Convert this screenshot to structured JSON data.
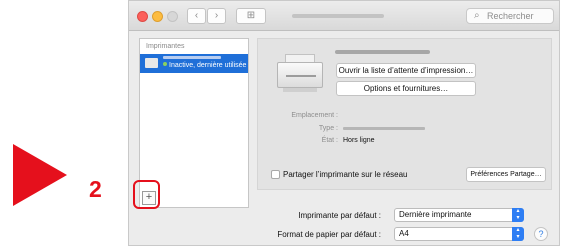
{
  "callout": {
    "step_number": "2",
    "color": "#e5101c"
  },
  "titlebar": {
    "nav_back": "‹",
    "nav_forward": "›",
    "grid_icon": "⊞",
    "search_placeholder": "Rechercher"
  },
  "sidebar": {
    "header": "Imprimantes",
    "items": [
      {
        "status": "Inactive, dernière utilisée",
        "selected": true
      }
    ],
    "add_label": "+"
  },
  "detail": {
    "open_queue_label": "Ouvrir la liste d’attente d’impression…",
    "options_label": "Options et fournitures…",
    "location_label": "Emplacement :",
    "type_label": "Type :",
    "state_label": "État :",
    "state_value": "Hors ligne",
    "share_label": "Partager l’imprimante sur le réseau",
    "share_prefs_label": "Préférences Partage…"
  },
  "defaults": {
    "default_printer_label": "Imprimante par défaut :",
    "default_printer_value": "Dernière imprimante",
    "paper_label": "Format de papier par défaut :",
    "paper_value": "A4",
    "help_label": "?"
  },
  "colors": {
    "accent": "#2e7ef4",
    "selection": "#1f6fd8",
    "status_dot": "#8ad05f"
  }
}
